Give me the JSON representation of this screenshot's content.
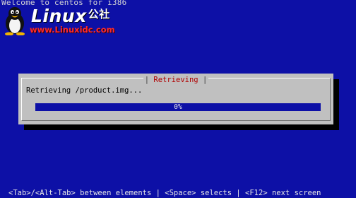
{
  "screen": {
    "background_color": "#0d10a6",
    "welcome_text": "Welcome to centos for i386"
  },
  "watermark": {
    "logo_text": "Linux",
    "logo_cn": "公社",
    "url": "www.Linuxidc.com",
    "icon": "tux-penguin-icon"
  },
  "dialog": {
    "title": "Retrieving",
    "message": "Retrieving /product.img...",
    "progress_fraction": 0,
    "progress_label": "0%",
    "bg_color": "#c0c0c0",
    "title_color": "#b00000"
  },
  "helpline": {
    "text": "<Tab>/<Alt-Tab> between elements  | <Space> selects | <F12> next screen"
  }
}
